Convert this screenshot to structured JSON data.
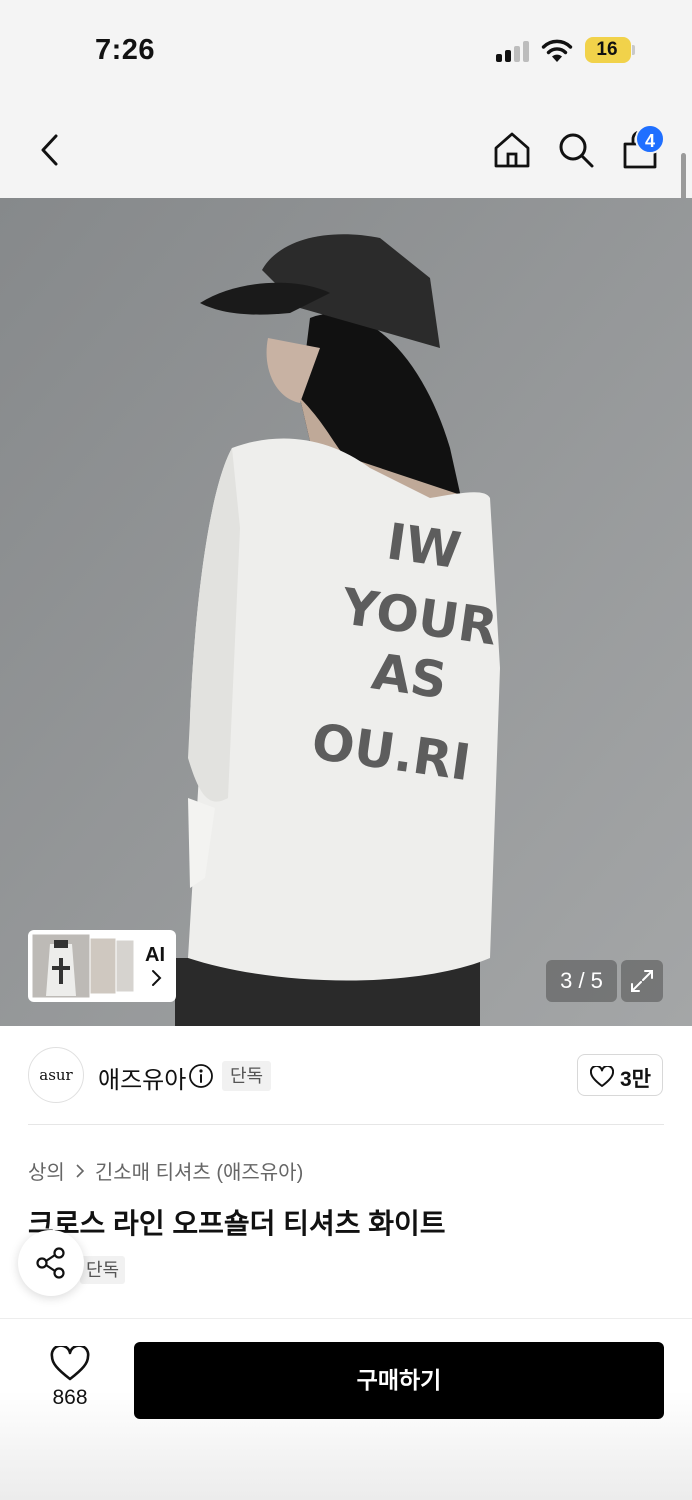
{
  "status_bar": {
    "time": "7:26",
    "battery": "16"
  },
  "nav": {
    "cart_count": "4",
    "icons": [
      "back-icon",
      "home-icon",
      "search-icon",
      "shopping-bag-icon"
    ]
  },
  "gallery": {
    "counter": "3 / 5",
    "ai_label": "AI",
    "current_page": 3,
    "total_pages": 5
  },
  "brand": {
    "logo_text": "asur",
    "name": "애즈유아",
    "exclusive_label": "단독",
    "like_count": "3만"
  },
  "breadcrumb": {
    "category": "상의",
    "subcategory": "긴소매 티셔츠 (애즈유아)"
  },
  "product": {
    "title": "크로스 라인 오프숄더 티셔츠 화이트",
    "exclusive_label": "단독"
  },
  "bottom_bar": {
    "wish_count": "868",
    "buy_label": "구매하기"
  },
  "colors": {
    "badge": "#1f6fff",
    "buy_button": "#000000",
    "battery": "#f1d24a"
  }
}
